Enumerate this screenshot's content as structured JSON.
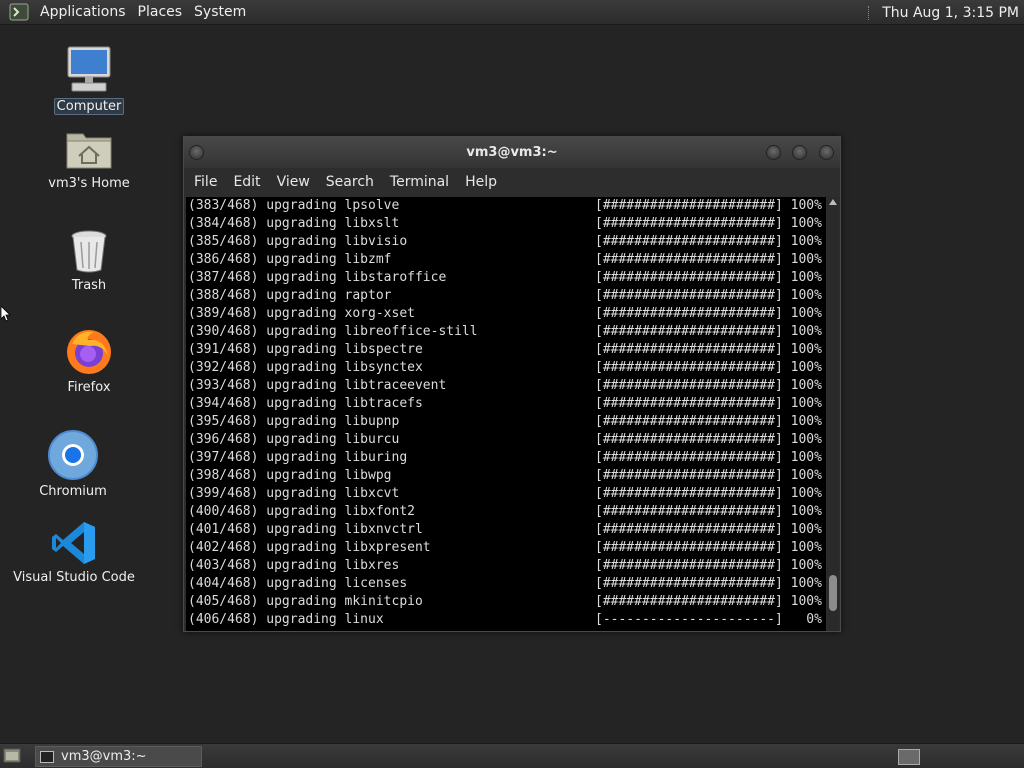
{
  "top_panel": {
    "menus": [
      "Applications",
      "Places",
      "System"
    ],
    "clock": "Thu Aug  1,  3:15 PM"
  },
  "desktop_icons": [
    {
      "label": "Computer"
    },
    {
      "label": "vm3's Home"
    },
    {
      "label": "Trash"
    },
    {
      "label": "Firefox"
    },
    {
      "label": "Chromium"
    },
    {
      "label": "Visual Studio Code"
    }
  ],
  "window": {
    "title": "vm3@vm3:~",
    "menu": [
      "File",
      "Edit",
      "View",
      "Search",
      "Terminal",
      "Help"
    ]
  },
  "terminal_lines": [
    "(383/468) upgrading lpsolve                         [######################] 100%",
    "(384/468) upgrading libxslt                         [######################] 100%",
    "(385/468) upgrading libvisio                        [######################] 100%",
    "(386/468) upgrading libzmf                          [######################] 100%",
    "(387/468) upgrading libstaroffice                   [######################] 100%",
    "(388/468) upgrading raptor                          [######################] 100%",
    "(389/468) upgrading xorg-xset                       [######################] 100%",
    "(390/468) upgrading libreoffice-still               [######################] 100%",
    "(391/468) upgrading libspectre                      [######################] 100%",
    "(392/468) upgrading libsynctex                      [######################] 100%",
    "(393/468) upgrading libtraceevent                   [######################] 100%",
    "(394/468) upgrading libtracefs                      [######################] 100%",
    "(395/468) upgrading libupnp                         [######################] 100%",
    "(396/468) upgrading liburcu                         [######################] 100%",
    "(397/468) upgrading liburing                        [######################] 100%",
    "(398/468) upgrading libwpg                          [######################] 100%",
    "(399/468) upgrading libxcvt                         [######################] 100%",
    "(400/468) upgrading libxfont2                       [######################] 100%",
    "(401/468) upgrading libxnvctrl                      [######################] 100%",
    "(402/468) upgrading libxpresent                     [######################] 100%",
    "(403/468) upgrading libxres                         [######################] 100%",
    "(404/468) upgrading licenses                        [######################] 100%",
    "(405/468) upgrading mkinitcpio                      [######################] 100%",
    "(406/468) upgrading linux                           [----------------------]   0%"
  ],
  "taskbar": {
    "window_label": "vm3@vm3:~"
  },
  "icons": {
    "menu_logo": "terminal-logo-icon",
    "show_desktop": "show-desktop-icon",
    "workspace": "workspace-switcher-icon"
  }
}
